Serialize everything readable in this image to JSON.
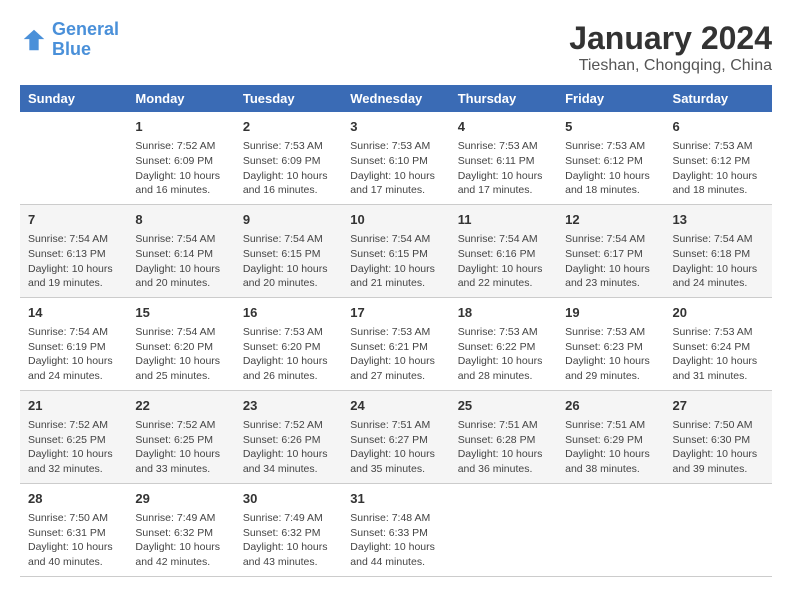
{
  "header": {
    "logo_line1": "General",
    "logo_line2": "Blue",
    "title": "January 2024",
    "subtitle": "Tieshan, Chongqing, China"
  },
  "weekdays": [
    "Sunday",
    "Monday",
    "Tuesday",
    "Wednesday",
    "Thursday",
    "Friday",
    "Saturday"
  ],
  "weeks": [
    [
      {
        "day": "",
        "info": ""
      },
      {
        "day": "1",
        "info": "Sunrise: 7:52 AM\nSunset: 6:09 PM\nDaylight: 10 hours\nand 16 minutes."
      },
      {
        "day": "2",
        "info": "Sunrise: 7:53 AM\nSunset: 6:09 PM\nDaylight: 10 hours\nand 16 minutes."
      },
      {
        "day": "3",
        "info": "Sunrise: 7:53 AM\nSunset: 6:10 PM\nDaylight: 10 hours\nand 17 minutes."
      },
      {
        "day": "4",
        "info": "Sunrise: 7:53 AM\nSunset: 6:11 PM\nDaylight: 10 hours\nand 17 minutes."
      },
      {
        "day": "5",
        "info": "Sunrise: 7:53 AM\nSunset: 6:12 PM\nDaylight: 10 hours\nand 18 minutes."
      },
      {
        "day": "6",
        "info": "Sunrise: 7:53 AM\nSunset: 6:12 PM\nDaylight: 10 hours\nand 18 minutes."
      }
    ],
    [
      {
        "day": "7",
        "info": "Sunrise: 7:54 AM\nSunset: 6:13 PM\nDaylight: 10 hours\nand 19 minutes."
      },
      {
        "day": "8",
        "info": "Sunrise: 7:54 AM\nSunset: 6:14 PM\nDaylight: 10 hours\nand 20 minutes."
      },
      {
        "day": "9",
        "info": "Sunrise: 7:54 AM\nSunset: 6:15 PM\nDaylight: 10 hours\nand 20 minutes."
      },
      {
        "day": "10",
        "info": "Sunrise: 7:54 AM\nSunset: 6:15 PM\nDaylight: 10 hours\nand 21 minutes."
      },
      {
        "day": "11",
        "info": "Sunrise: 7:54 AM\nSunset: 6:16 PM\nDaylight: 10 hours\nand 22 minutes."
      },
      {
        "day": "12",
        "info": "Sunrise: 7:54 AM\nSunset: 6:17 PM\nDaylight: 10 hours\nand 23 minutes."
      },
      {
        "day": "13",
        "info": "Sunrise: 7:54 AM\nSunset: 6:18 PM\nDaylight: 10 hours\nand 24 minutes."
      }
    ],
    [
      {
        "day": "14",
        "info": "Sunrise: 7:54 AM\nSunset: 6:19 PM\nDaylight: 10 hours\nand 24 minutes."
      },
      {
        "day": "15",
        "info": "Sunrise: 7:54 AM\nSunset: 6:20 PM\nDaylight: 10 hours\nand 25 minutes."
      },
      {
        "day": "16",
        "info": "Sunrise: 7:53 AM\nSunset: 6:20 PM\nDaylight: 10 hours\nand 26 minutes."
      },
      {
        "day": "17",
        "info": "Sunrise: 7:53 AM\nSunset: 6:21 PM\nDaylight: 10 hours\nand 27 minutes."
      },
      {
        "day": "18",
        "info": "Sunrise: 7:53 AM\nSunset: 6:22 PM\nDaylight: 10 hours\nand 28 minutes."
      },
      {
        "day": "19",
        "info": "Sunrise: 7:53 AM\nSunset: 6:23 PM\nDaylight: 10 hours\nand 29 minutes."
      },
      {
        "day": "20",
        "info": "Sunrise: 7:53 AM\nSunset: 6:24 PM\nDaylight: 10 hours\nand 31 minutes."
      }
    ],
    [
      {
        "day": "21",
        "info": "Sunrise: 7:52 AM\nSunset: 6:25 PM\nDaylight: 10 hours\nand 32 minutes."
      },
      {
        "day": "22",
        "info": "Sunrise: 7:52 AM\nSunset: 6:25 PM\nDaylight: 10 hours\nand 33 minutes."
      },
      {
        "day": "23",
        "info": "Sunrise: 7:52 AM\nSunset: 6:26 PM\nDaylight: 10 hours\nand 34 minutes."
      },
      {
        "day": "24",
        "info": "Sunrise: 7:51 AM\nSunset: 6:27 PM\nDaylight: 10 hours\nand 35 minutes."
      },
      {
        "day": "25",
        "info": "Sunrise: 7:51 AM\nSunset: 6:28 PM\nDaylight: 10 hours\nand 36 minutes."
      },
      {
        "day": "26",
        "info": "Sunrise: 7:51 AM\nSunset: 6:29 PM\nDaylight: 10 hours\nand 38 minutes."
      },
      {
        "day": "27",
        "info": "Sunrise: 7:50 AM\nSunset: 6:30 PM\nDaylight: 10 hours\nand 39 minutes."
      }
    ],
    [
      {
        "day": "28",
        "info": "Sunrise: 7:50 AM\nSunset: 6:31 PM\nDaylight: 10 hours\nand 40 minutes."
      },
      {
        "day": "29",
        "info": "Sunrise: 7:49 AM\nSunset: 6:32 PM\nDaylight: 10 hours\nand 42 minutes."
      },
      {
        "day": "30",
        "info": "Sunrise: 7:49 AM\nSunset: 6:32 PM\nDaylight: 10 hours\nand 43 minutes."
      },
      {
        "day": "31",
        "info": "Sunrise: 7:48 AM\nSunset: 6:33 PM\nDaylight: 10 hours\nand 44 minutes."
      },
      {
        "day": "",
        "info": ""
      },
      {
        "day": "",
        "info": ""
      },
      {
        "day": "",
        "info": ""
      }
    ]
  ]
}
